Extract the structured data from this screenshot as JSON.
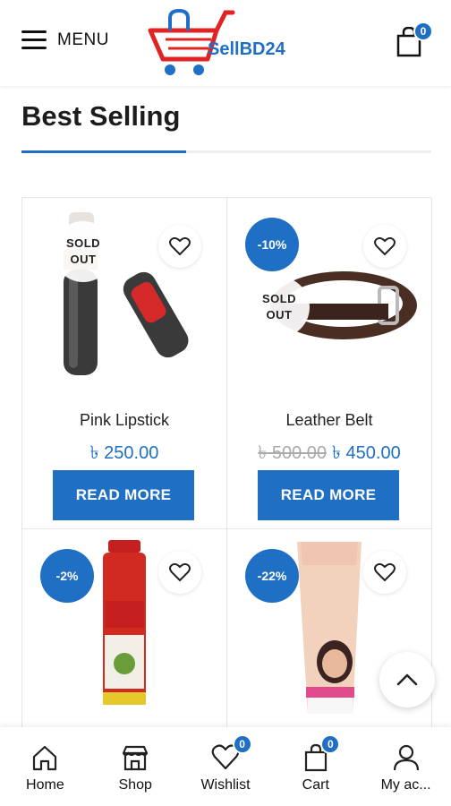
{
  "header": {
    "menu_label": "MENU",
    "logo_text": "SellBD24",
    "cart_count": "0"
  },
  "section": {
    "title": "Best Selling"
  },
  "products": [
    {
      "name": "Pink Lipstick",
      "price": "৳ 250.00",
      "old_price": "",
      "discount": "",
      "sold_out": "SOLD\nOUT",
      "button": "READ MORE"
    },
    {
      "name": "Leather Belt",
      "price": "৳ 450.00",
      "old_price": "৳ 500.00",
      "discount": "-10%",
      "sold_out": "SOLD\nOUT",
      "button": "READ MORE"
    },
    {
      "name": "",
      "price": "",
      "old_price": "",
      "discount": "-2%",
      "sold_out": "",
      "button": ""
    },
    {
      "name": "",
      "price": "",
      "old_price": "",
      "discount": "-22%",
      "sold_out": "",
      "button": ""
    }
  ],
  "bottom_nav": {
    "items": [
      {
        "label": "Home",
        "icon": "home-icon"
      },
      {
        "label": "Shop",
        "icon": "shop-icon"
      },
      {
        "label": "Wishlist",
        "icon": "heart-icon",
        "badge": "0"
      },
      {
        "label": "Cart",
        "icon": "cart-icon",
        "badge": "0"
      },
      {
        "label": "My ac...",
        "icon": "user-icon"
      }
    ]
  },
  "colors": {
    "accent": "#1f6fc4",
    "logo_red": "#e02424"
  }
}
